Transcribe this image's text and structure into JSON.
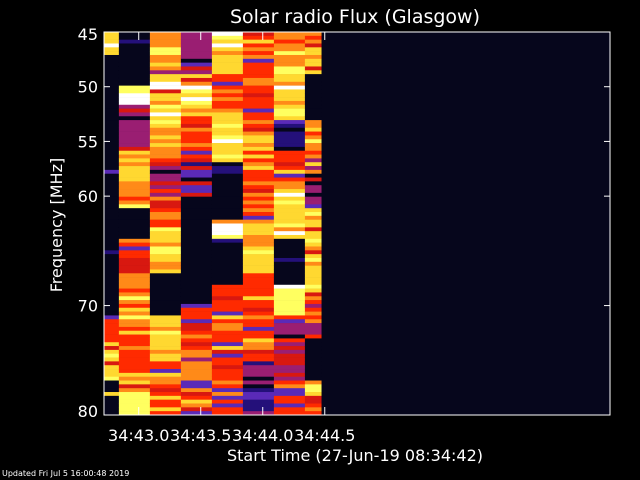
{
  "chart_data": {
    "type": "heatmap",
    "title": "Solar radio Flux (Glasgow)",
    "ylabel": "Frequency [MHz]",
    "xlabel": "Start Time (27-Jun-19 08:34:42)",
    "y_reversed": true,
    "ylim": [
      80,
      45
    ],
    "xlim": [
      0.72,
      4.8
    ],
    "y_ticks": [
      45,
      50,
      55,
      60,
      70,
      80
    ],
    "y_tick_labels": [
      "45",
      "50",
      "55",
      "60",
      "70",
      "80"
    ],
    "x_ticks": [
      1.0,
      1.5,
      2.0,
      2.5
    ],
    "x_tick_labels": [
      "34:43.0",
      "34:43.5",
      "34:44.0",
      "34:44.5"
    ],
    "colormap": [
      "#06061c",
      "#24107a",
      "#5a2ab8",
      "#9a1e72",
      "#d81810",
      "#ff2a00",
      "#ff8a18",
      "#ffd830",
      "#ffff60",
      "#ffffff"
    ],
    "time_columns": [
      {
        "start": 0.72,
        "end": 0.84
      },
      {
        "start": 0.84,
        "end": 1.09
      },
      {
        "start": 1.09,
        "end": 1.34
      },
      {
        "start": 1.34,
        "end": 1.59
      },
      {
        "start": 1.59,
        "end": 1.84
      },
      {
        "start": 1.84,
        "end": 2.09
      },
      {
        "start": 2.09,
        "end": 2.34
      },
      {
        "start": 2.34,
        "end": 2.47
      }
    ],
    "bands": [
      [
        {
          "f0": 45.0,
          "f1": 47.0,
          "level": 7
        },
        {
          "f0": 47.0,
          "f1": 49.5,
          "level": 0
        },
        {
          "f0": 49.5,
          "f1": 53.0,
          "level": 0
        },
        {
          "f0": 53.0,
          "f1": 62.0,
          "level": 0
        },
        {
          "f0": 62.0,
          "f1": 71.0,
          "level": 0
        },
        {
          "f0": 71.0,
          "f1": 74.0,
          "level": 5
        },
        {
          "f0": 74.0,
          "f1": 77.0,
          "level": 7
        },
        {
          "f0": 77.0,
          "f1": 80.0,
          "level": 0
        }
      ],
      [
        {
          "f0": 45.0,
          "f1": 50.0,
          "level": 0
        },
        {
          "f0": 50.0,
          "f1": 51.5,
          "level": 8
        },
        {
          "f0": 51.5,
          "f1": 56.0,
          "level": 3
        },
        {
          "f0": 56.0,
          "f1": 58.5,
          "level": 7
        },
        {
          "f0": 58.5,
          "f1": 61.0,
          "level": 6
        },
        {
          "f0": 61.0,
          "f1": 64.0,
          "level": 0
        },
        {
          "f0": 64.0,
          "f1": 67.0,
          "level": 5
        },
        {
          "f0": 67.0,
          "f1": 72.0,
          "level": 6
        },
        {
          "f0": 72.0,
          "f1": 76.0,
          "level": 5
        },
        {
          "f0": 76.0,
          "f1": 78.0,
          "level": 7
        },
        {
          "f0": 78.0,
          "f1": 80.0,
          "level": 8
        }
      ],
      [
        {
          "f0": 45.0,
          "f1": 49.0,
          "level": 6
        },
        {
          "f0": 49.0,
          "f1": 53.0,
          "level": 7
        },
        {
          "f0": 53.0,
          "f1": 57.0,
          "level": 6
        },
        {
          "f0": 57.0,
          "f1": 60.0,
          "level": 3
        },
        {
          "f0": 60.0,
          "f1": 63.0,
          "level": 5
        },
        {
          "f0": 63.0,
          "f1": 67.0,
          "level": 7
        },
        {
          "f0": 67.0,
          "f1": 71.0,
          "level": 0
        },
        {
          "f0": 71.0,
          "f1": 75.0,
          "level": 7
        },
        {
          "f0": 75.0,
          "f1": 77.0,
          "level": 5
        },
        {
          "f0": 77.0,
          "f1": 80.0,
          "level": 5
        }
      ],
      [
        {
          "f0": 45.0,
          "f1": 49.0,
          "level": 3
        },
        {
          "f0": 49.0,
          "f1": 52.0,
          "level": 7
        },
        {
          "f0": 52.0,
          "f1": 57.0,
          "level": 5
        },
        {
          "f0": 57.0,
          "f1": 60.0,
          "level": 2
        },
        {
          "f0": 60.0,
          "f1": 70.0,
          "level": 0
        },
        {
          "f0": 70.0,
          "f1": 74.0,
          "level": 5
        },
        {
          "f0": 74.0,
          "f1": 77.0,
          "level": 6
        },
        {
          "f0": 77.0,
          "f1": 80.0,
          "level": 5
        }
      ],
      [
        {
          "f0": 45.0,
          "f1": 49.0,
          "level": 7
        },
        {
          "f0": 49.0,
          "f1": 52.0,
          "level": 5
        },
        {
          "f0": 52.0,
          "f1": 57.0,
          "level": 7
        },
        {
          "f0": 57.0,
          "f1": 62.0,
          "level": 0
        },
        {
          "f0": 62.0,
          "f1": 64.0,
          "level": 9
        },
        {
          "f0": 64.0,
          "f1": 68.0,
          "level": 0
        },
        {
          "f0": 68.0,
          "f1": 77.0,
          "level": 5
        },
        {
          "f0": 77.0,
          "f1": 80.0,
          "level": 5
        }
      ],
      [
        {
          "f0": 45.0,
          "f1": 47.0,
          "level": 5
        },
        {
          "f0": 47.0,
          "f1": 54.0,
          "level": 5
        },
        {
          "f0": 54.0,
          "f1": 58.0,
          "level": 6
        },
        {
          "f0": 58.0,
          "f1": 63.0,
          "level": 5
        },
        {
          "f0": 63.0,
          "f1": 67.0,
          "level": 7
        },
        {
          "f0": 67.0,
          "f1": 70.0,
          "level": 5
        },
        {
          "f0": 70.0,
          "f1": 75.0,
          "level": 5
        },
        {
          "f0": 75.0,
          "f1": 80.0,
          "level": 1
        }
      ],
      [
        {
          "f0": 45.0,
          "f1": 48.0,
          "level": 6
        },
        {
          "f0": 48.0,
          "f1": 53.0,
          "level": 7
        },
        {
          "f0": 53.0,
          "f1": 56.0,
          "level": 1
        },
        {
          "f0": 56.0,
          "f1": 59.0,
          "level": 5
        },
        {
          "f0": 59.0,
          "f1": 64.0,
          "level": 7
        },
        {
          "f0": 64.0,
          "f1": 68.0,
          "level": 0
        },
        {
          "f0": 68.0,
          "f1": 71.0,
          "level": 8
        },
        {
          "f0": 71.0,
          "f1": 77.0,
          "level": 3
        },
        {
          "f0": 77.0,
          "f1": 80.0,
          "level": 5
        }
      ],
      [
        {
          "f0": 45.0,
          "f1": 46.5,
          "level": 5
        },
        {
          "f0": 46.5,
          "f1": 49.0,
          "level": 7
        },
        {
          "f0": 49.0,
          "f1": 53.0,
          "level": 0
        },
        {
          "f0": 53.0,
          "f1": 58.0,
          "level": 6
        },
        {
          "f0": 58.0,
          "f1": 61.0,
          "level": 3
        },
        {
          "f0": 61.0,
          "f1": 69.0,
          "level": 7
        },
        {
          "f0": 69.0,
          "f1": 73.0,
          "level": 6
        },
        {
          "f0": 73.0,
          "f1": 77.0,
          "level": 0
        },
        {
          "f0": 77.0,
          "f1": 79.0,
          "level": 7
        },
        {
          "f0": 79.0,
          "f1": 80.0,
          "level": 5
        }
      ]
    ]
  },
  "footer": {
    "updated_text": "Updated Fri Jul  5 16:00:48 2019"
  }
}
